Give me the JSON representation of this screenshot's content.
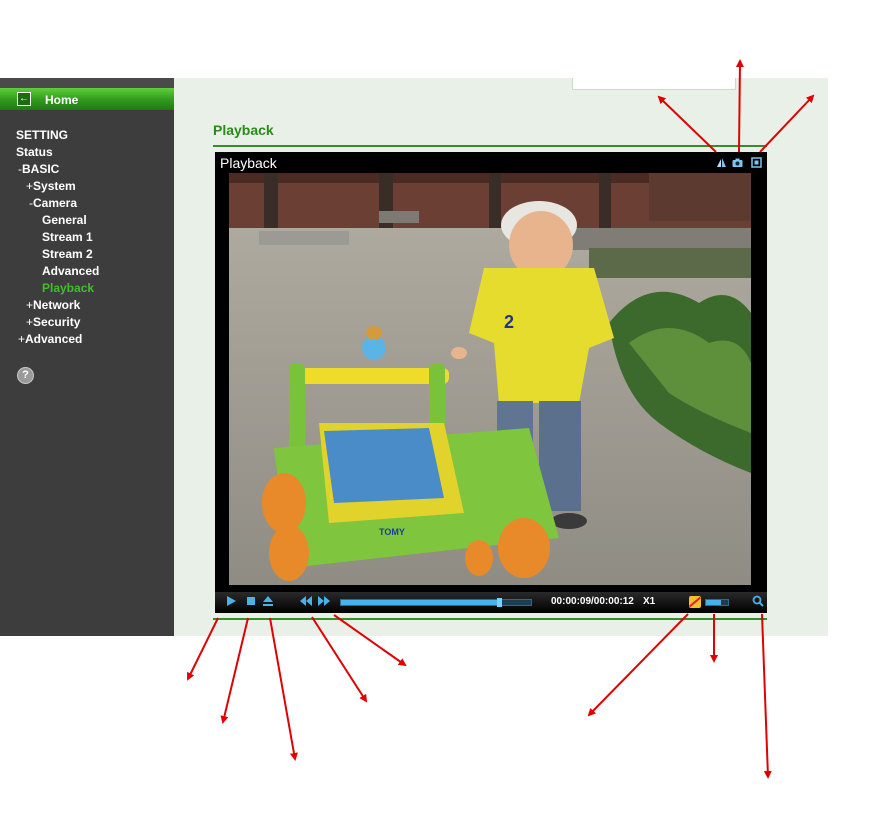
{
  "sidebar": {
    "home_label": "Home",
    "setting": "SETTING",
    "status": "Status",
    "basic": "BASIC",
    "system": "System",
    "camera": "Camera",
    "general": "General",
    "stream1": "Stream 1",
    "stream2": "Stream 2",
    "advanced_cam": "Advanced",
    "playback": "Playback",
    "network": "Network",
    "security": "Security",
    "advanced": "Advanced",
    "minus": "-",
    "plus": "+",
    "help_glyph": "?"
  },
  "main": {
    "page_title": "Playback"
  },
  "player": {
    "title": "Playback",
    "time": "00:00:09/00:00:12",
    "speed": "X1",
    "progress": 0.83,
    "volume": 0.7,
    "toy_brand": "TOMY",
    "shirt_number": "2",
    "icons": {
      "header": [
        "image-adjust-icon",
        "snapshot-icon",
        "fullscreen-icon"
      ],
      "controls": [
        "play-icon",
        "stop-icon",
        "eject-icon",
        "rewind-icon",
        "fast-forward-icon",
        "mute-icon",
        "zoom-icon"
      ]
    }
  },
  "colors": {
    "accent_green": "#2a8a1a",
    "player_blue": "#4ab2ea",
    "annotation_red": "#e00000"
  }
}
